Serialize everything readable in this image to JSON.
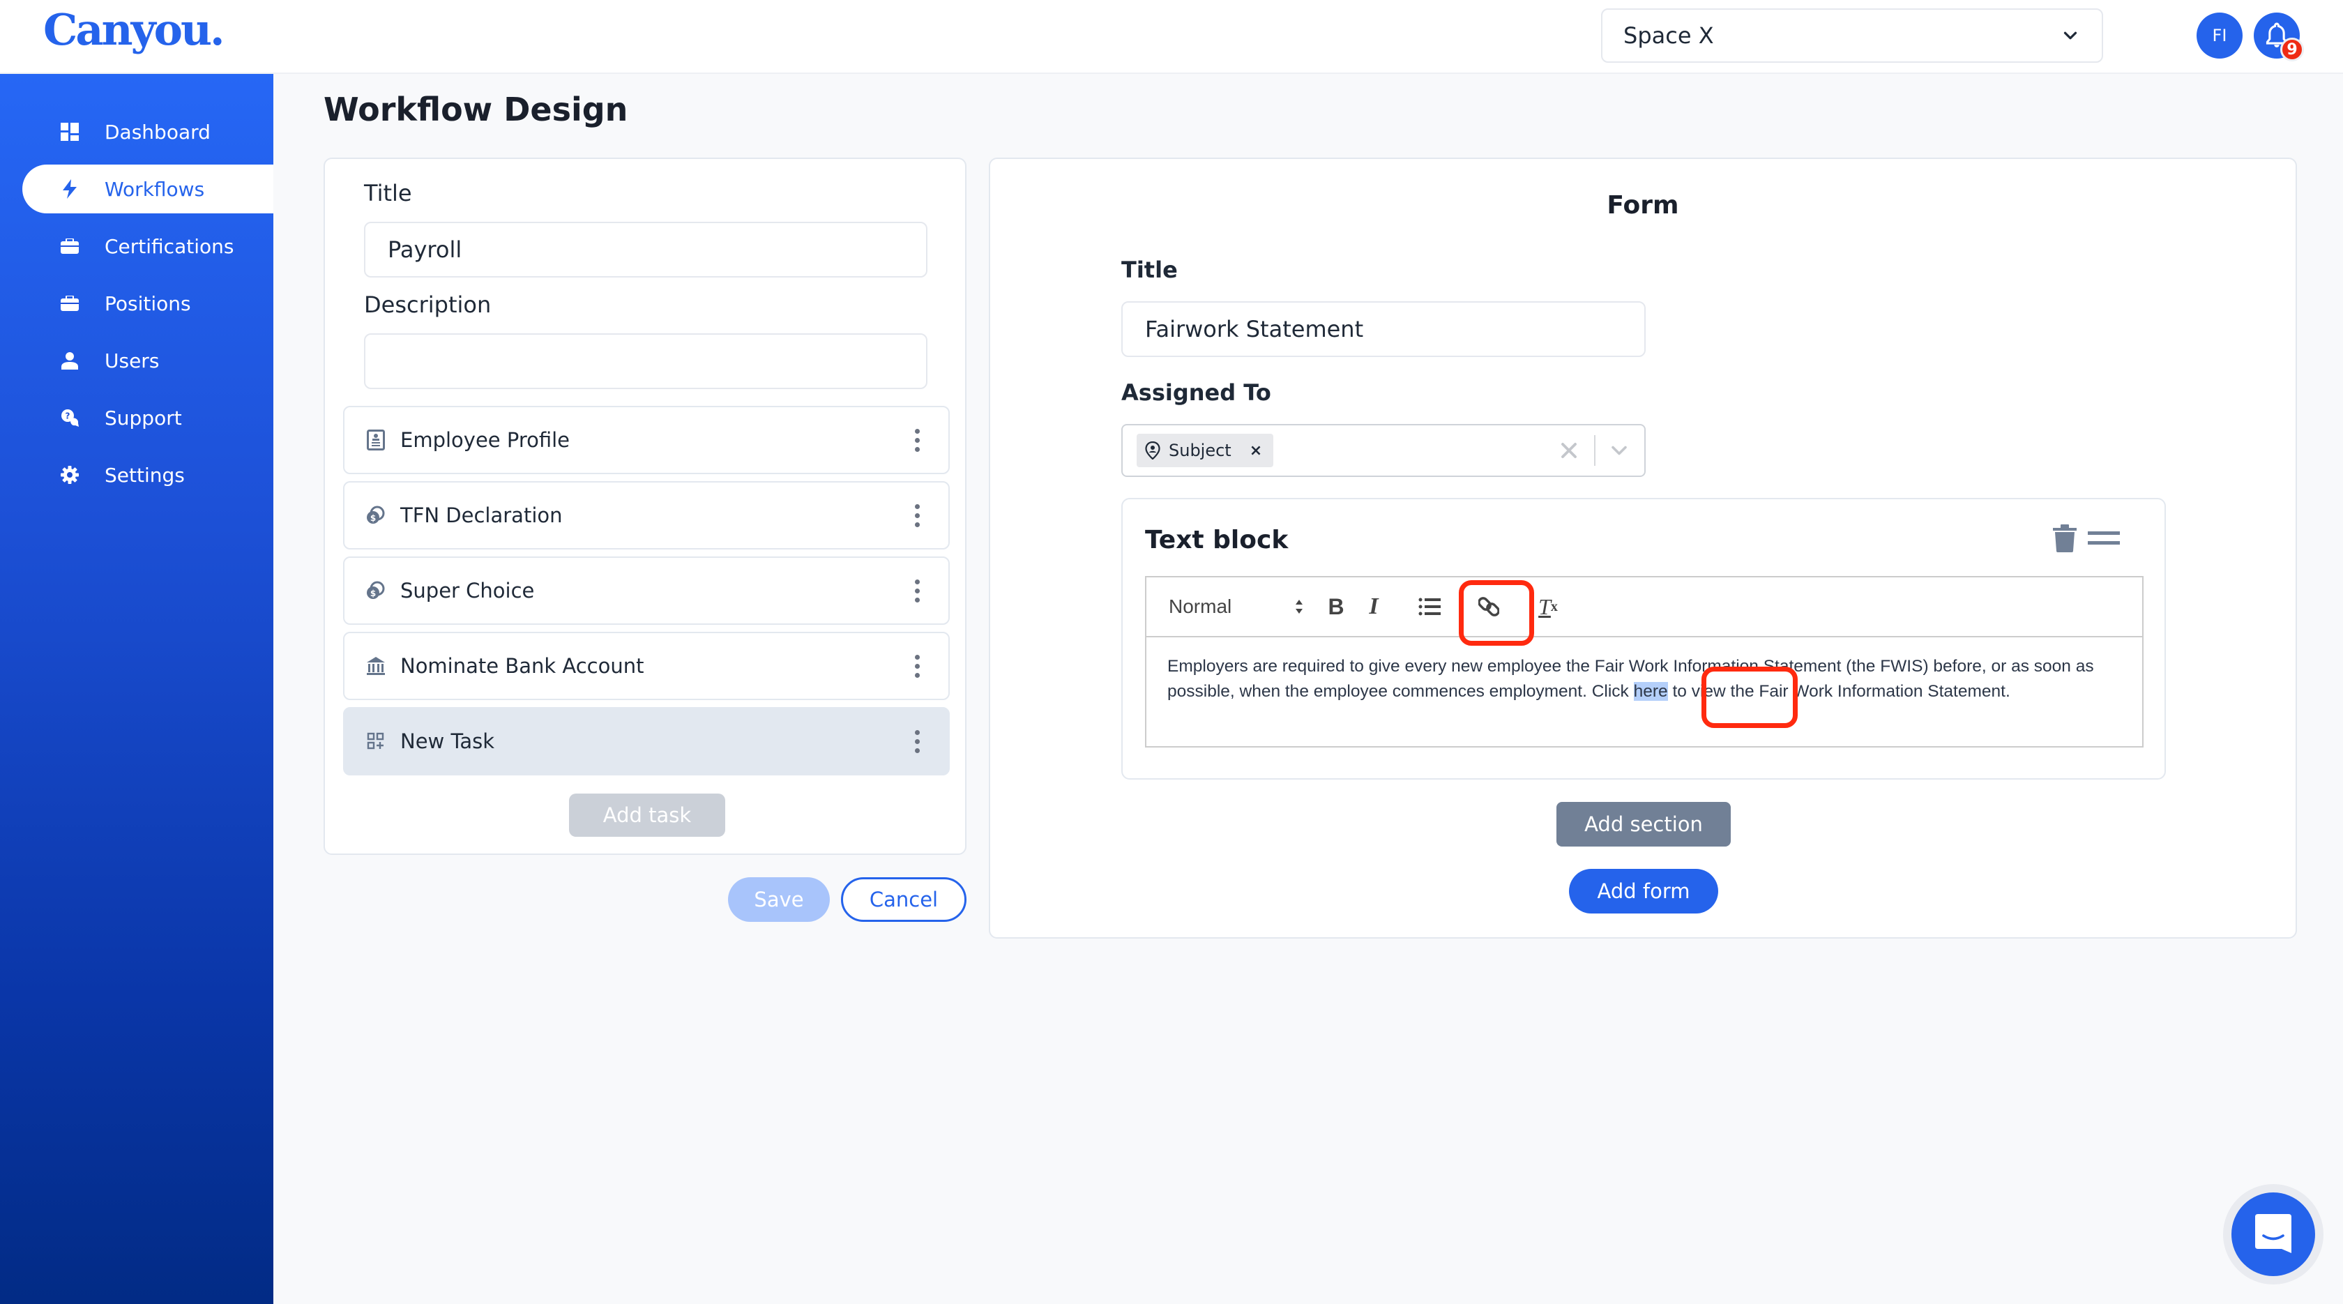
{
  "app": {
    "logo": "Canyou.",
    "brand_color": "#2563eb"
  },
  "header": {
    "space_select": {
      "value": "Space X"
    },
    "avatar_initials": "FI",
    "notifications_count": "9"
  },
  "sidebar": {
    "items": [
      {
        "label": "Dashboard",
        "icon": "dashboard-icon",
        "active": false
      },
      {
        "label": "Workflows",
        "icon": "lightning-icon",
        "active": true
      },
      {
        "label": "Certifications",
        "icon": "briefcase-icon",
        "active": false
      },
      {
        "label": "Positions",
        "icon": "briefcase-icon",
        "active": false
      },
      {
        "label": "Users",
        "icon": "user-icon",
        "active": false
      },
      {
        "label": "Support",
        "icon": "support-chat-icon",
        "active": false
      },
      {
        "label": "Settings",
        "icon": "gear-icon",
        "active": false
      }
    ]
  },
  "page": {
    "title": "Workflow Design"
  },
  "workflow": {
    "title_label": "Title",
    "title_value": "Payroll",
    "description_label": "Description",
    "description_value": "",
    "tasks": [
      {
        "label": "Employee Profile",
        "icon": "profile-card-icon",
        "selected": false
      },
      {
        "label": "TFN Declaration",
        "icon": "coin-icon",
        "selected": false
      },
      {
        "label": "Super Choice",
        "icon": "coin-icon",
        "selected": false
      },
      {
        "label": "Nominate Bank Account",
        "icon": "bank-icon",
        "selected": false
      },
      {
        "label": "New Task",
        "icon": "add-grid-icon",
        "selected": true
      }
    ],
    "add_task_label": "Add task",
    "save_label": "Save",
    "cancel_label": "Cancel"
  },
  "form": {
    "heading": "Form",
    "title_label": "Title",
    "title_value": "Fairwork Statement",
    "assigned_label": "Assigned To",
    "assigned_chips": [
      {
        "label": "Subject",
        "icon": "person-pin-icon"
      }
    ],
    "text_block": {
      "title": "Text block",
      "header_format": "Normal",
      "toolbar": [
        "header-select",
        "bold",
        "italic",
        "bullet-list",
        "link",
        "clear-format"
      ],
      "content_before": "Employers are required to give every new employee the Fair Work Information Statement (the FWIS) before, or as soon as possible, when the employee commences employment. Click ",
      "content_selected": "here",
      "content_after": " to view the Fair Work Information Statement."
    },
    "add_section_label": "Add section",
    "add_form_label": "Add form"
  },
  "annotations": {
    "highlight_color": "#ff2a0f",
    "highlighted": [
      "link-button",
      "selected-text-here"
    ]
  }
}
